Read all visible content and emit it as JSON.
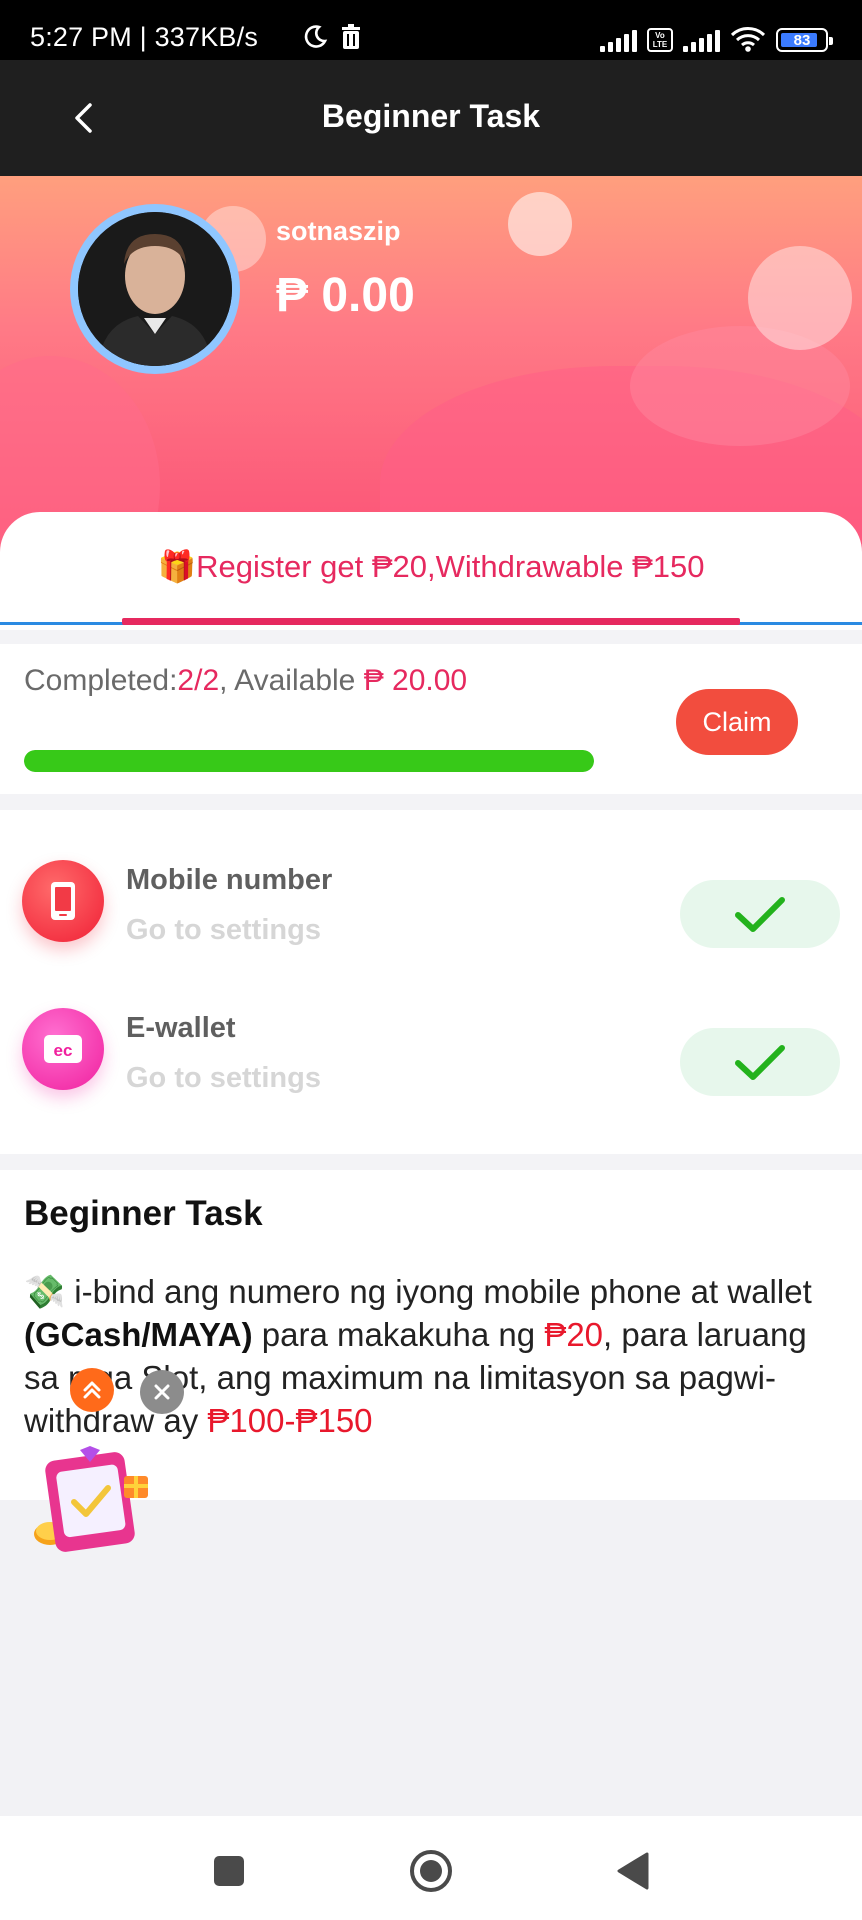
{
  "status_bar": {
    "time_speed": "5:27 PM | 337KB/s",
    "volte_label": "Vo LTE",
    "battery_level": "83",
    "icons": [
      "moon-icon",
      "trash-icon",
      "signal-icon",
      "volte-icon",
      "signal-icon",
      "wifi-icon",
      "battery-icon"
    ]
  },
  "header": {
    "title": "Beginner Task",
    "back_icon": "chevron-left-icon"
  },
  "profile": {
    "username": "sotnaszip",
    "balance": "₱ 0.00"
  },
  "tab": {
    "label": "🎁Register get ₱20,Withdrawable ₱150"
  },
  "progress": {
    "completed_label": "Completed:",
    "completed_value": "2/2",
    "available_label": ", Available ",
    "available_value": "₱ 20.00",
    "claim_label": "Claim",
    "fill_fraction": 1.0
  },
  "tasks": [
    {
      "name": "Mobile number",
      "action": "Go to settings",
      "icon": "phone-icon",
      "done": true
    },
    {
      "name": "E-wallet",
      "action": "Go to settings",
      "icon": "wallet-icon",
      "done": true
    }
  ],
  "description": {
    "title": "Beginner Task",
    "emoji": "💸",
    "p1": " i-bind ang numero ng iyong mobile phone at wallet ",
    "bold": "(GCash/MAYA)",
    "p2": " para makakuha ng ",
    "amount1": "₱20",
    "p3": ", para laruang sa mga Slot, ang maximum na limitasyon sa pagwi-withdraw ay ",
    "amount2": "₱100-₱150"
  },
  "colors": {
    "accent": "#e6295f",
    "progress": "#37c918",
    "claim": "#f24d3e",
    "header_bg": "#1f1f1f"
  },
  "navigation": {
    "icons": [
      "square-icon",
      "home-circle-icon",
      "back-triangle-icon"
    ]
  }
}
